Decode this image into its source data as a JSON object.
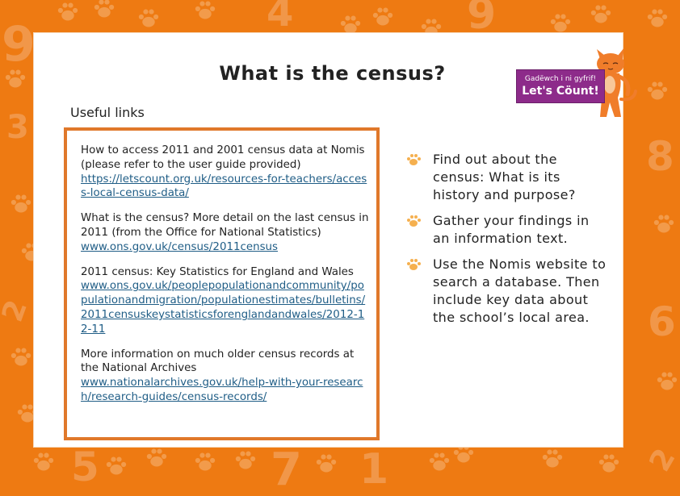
{
  "page": {
    "title": "What is the census?",
    "section_heading": "Useful links"
  },
  "logo": {
    "line1": "Gadëwch i ni gyfrif!",
    "line2": "Let's Cöunt!",
    "colors": {
      "banner": "#8d2b8a",
      "cat": "#f07d2a"
    }
  },
  "links": [
    {
      "description": "How to access 2011 and 2001 census data at Nomis (please refer to the user guide provided)",
      "url": "https://letscount.org.uk/resources-for-teachers/access-local-census-data/"
    },
    {
      "description": "What is the census? More detail on the last census in 2011 (from the Office for National Statistics)",
      "url": "www.ons.gov.uk/census/2011census"
    },
    {
      "description": "2011 census: Key Statistics for England and Wales",
      "url": "www.ons.gov.uk/peoplepopulationandcommunity/populationandmigration/populationestimates/bulletins/2011censuskeystatisticsforenglandandwales/2012-12-11"
    },
    {
      "description": "More information on much older census records at the National Archives",
      "url": "www.nationalarchives.gov.uk/help-with-your-research/research-guides/census-records/"
    }
  ],
  "tasks": [
    {
      "icon": "paw-print-icon",
      "text": "Find out about the census: What is its history and purpose?"
    },
    {
      "icon": "paw-print-icon",
      "text": "Gather your findings in an information text."
    },
    {
      "icon": "paw-print-icon",
      "text": "Use the Nomis website to search a database. Then include key data about the school’s local area."
    }
  ],
  "background": {
    "digits": [
      "9",
      "3",
      "2",
      "4",
      "9",
      "8",
      "6",
      "5",
      "7",
      "1",
      "2"
    ],
    "colors": {
      "border": "#ee7a12",
      "box_border": "#e0782a",
      "link": "#1f5d86",
      "bullet": "#f5b04f"
    }
  }
}
